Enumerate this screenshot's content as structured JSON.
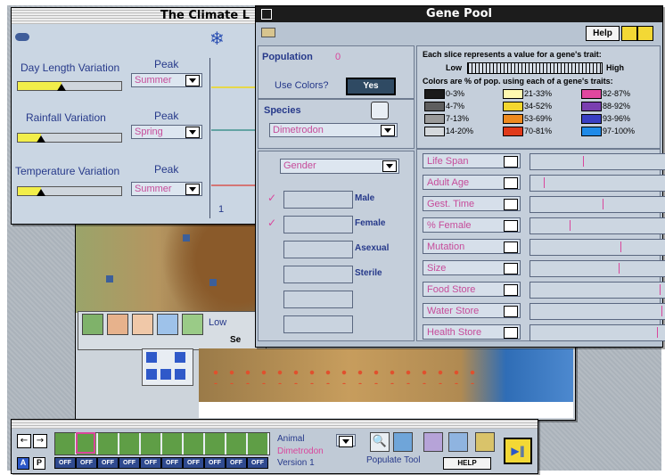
{
  "climate": {
    "title": "The Climate L",
    "day_label": "Day Length Variation",
    "rain_label": "Rainfall Variation",
    "temp_label": "Temperature Variation",
    "peak_label": "Peak",
    "day_peak": "Summer",
    "rain_peak": "Spring",
    "temp_peak": "Summer",
    "day_level": 0.42,
    "rain_level": 0.22,
    "temp_level": 0.22,
    "tick": "1"
  },
  "gene_pool": {
    "title": "Gene Pool",
    "help": "Help",
    "population_label": "Population",
    "population_value": "0",
    "use_colors_label": "Use Colors?",
    "use_colors_value": "Yes",
    "species_label": "Species",
    "species_value": "Dimetrodon",
    "slice_text": "Each slice represents a value for a gene's trait:",
    "low": "Low",
    "high": "High",
    "colors_text": "Colors are % of pop. using each of a gene's traits:",
    "legend": [
      {
        "label": "0-3%",
        "color": "#1a1a1a"
      },
      {
        "label": "4-7%",
        "color": "#5e5e5e"
      },
      {
        "label": "7-13%",
        "color": "#9a9a9a"
      },
      {
        "label": "14-20%",
        "color": "#d4d8dc"
      },
      {
        "label": "21-33%",
        "color": "#fff9b0"
      },
      {
        "label": "34-52%",
        "color": "#f3d62e"
      },
      {
        "label": "53-69%",
        "color": "#ee8a1e"
      },
      {
        "label": "70-81%",
        "color": "#e03a1a"
      },
      {
        "label": "82-87%",
        "color": "#e1479f"
      },
      {
        "label": "88-92%",
        "color": "#7a3fb0"
      },
      {
        "label": "93-96%",
        "color": "#3a3fc4"
      },
      {
        "label": "97-100%",
        "color": "#1f8ae8"
      }
    ],
    "gender_select": "Gender",
    "gender_rows": [
      {
        "check": "✓",
        "label": "Male"
      },
      {
        "check": "✓",
        "label": "Female"
      },
      {
        "check": "",
        "label": "Asexual"
      },
      {
        "check": "",
        "label": "Sterile"
      },
      {
        "check": "",
        "label": ""
      },
      {
        "check": "",
        "label": ""
      }
    ],
    "traits": [
      {
        "name": "Life Span",
        "marker": 0.4
      },
      {
        "name": "Adult Age",
        "marker": 0.1
      },
      {
        "name": "Gest. Time",
        "marker": 0.55
      },
      {
        "name": "% Female",
        "marker": 0.3
      },
      {
        "name": "Mutation",
        "marker": 0.68
      },
      {
        "name": "Size",
        "marker": 0.67
      },
      {
        "name": "Food Store",
        "marker": 0.98
      },
      {
        "name": "Water Store",
        "marker": 0.99
      },
      {
        "name": "Health Store",
        "marker": 0.96
      }
    ]
  },
  "map_window": {
    "low_label": "Low",
    "partial_label": "Se"
  },
  "bottom": {
    "animal_label": "Animal",
    "species": "Dimetrodon",
    "version": "Version 1",
    "populate_tool": "Populate Tool",
    "help": "HELP",
    "off": "OFF",
    "a_label": "A",
    "p_label": "P",
    "off_count": 10
  }
}
